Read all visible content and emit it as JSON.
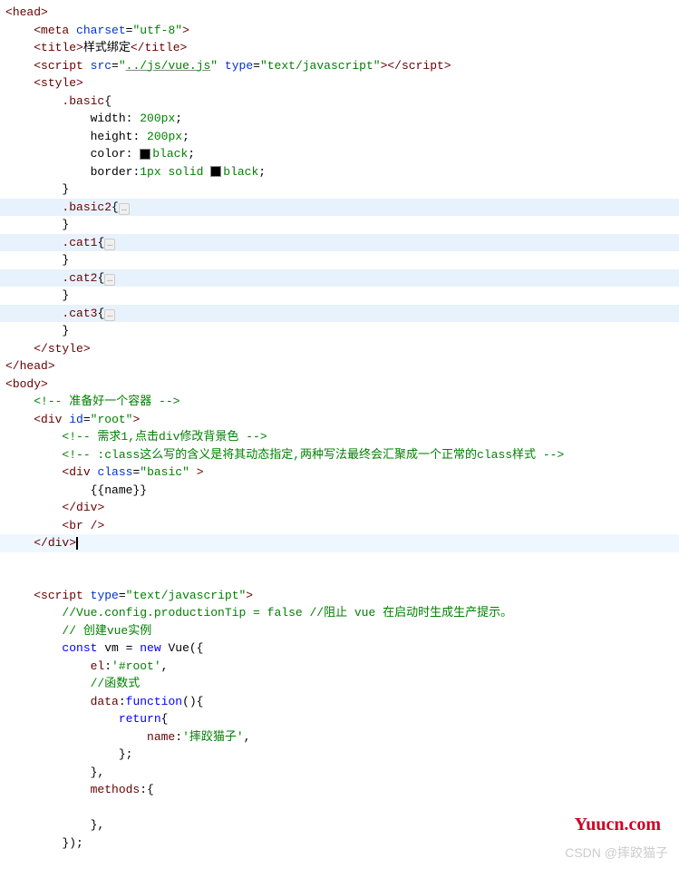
{
  "lines": [
    {
      "ind": 0,
      "segs": [
        {
          "t": "<",
          "c": "tag-bracket"
        },
        {
          "t": "head",
          "c": "tag-name"
        },
        {
          "t": ">",
          "c": "tag-bracket"
        }
      ]
    },
    {
      "ind": 1,
      "segs": [
        {
          "t": "<",
          "c": "tag-bracket"
        },
        {
          "t": "meta ",
          "c": "tag-name"
        },
        {
          "t": "charset",
          "c": "attr-name"
        },
        {
          "t": "=",
          "c": "plain"
        },
        {
          "t": "\"utf-8\"",
          "c": "attr-value"
        },
        {
          "t": ">",
          "c": "tag-bracket"
        }
      ]
    },
    {
      "ind": 1,
      "segs": [
        {
          "t": "<",
          "c": "tag-bracket"
        },
        {
          "t": "title",
          "c": "tag-name"
        },
        {
          "t": ">",
          "c": "tag-bracket"
        },
        {
          "t": "样式绑定",
          "c": "plain"
        },
        {
          "t": "</",
          "c": "tag-bracket"
        },
        {
          "t": "title",
          "c": "tag-name"
        },
        {
          "t": ">",
          "c": "tag-bracket"
        }
      ]
    },
    {
      "ind": 1,
      "segs": [
        {
          "t": "<",
          "c": "tag-bracket"
        },
        {
          "t": "script ",
          "c": "tag-name"
        },
        {
          "t": "src",
          "c": "attr-name"
        },
        {
          "t": "=",
          "c": "plain"
        },
        {
          "t": "\"",
          "c": "attr-value"
        },
        {
          "t": "../js/vue.js",
          "c": "attr-value-underline"
        },
        {
          "t": "\"",
          "c": "attr-value"
        },
        {
          "t": " ",
          "c": "plain"
        },
        {
          "t": "type",
          "c": "attr-name"
        },
        {
          "t": "=",
          "c": "plain"
        },
        {
          "t": "\"text/javascript\"",
          "c": "attr-value"
        },
        {
          "t": "></",
          "c": "tag-bracket"
        },
        {
          "t": "script",
          "c": "tag-name"
        },
        {
          "t": ">",
          "c": "tag-bracket"
        }
      ]
    },
    {
      "ind": 1,
      "segs": [
        {
          "t": "<",
          "c": "tag-bracket"
        },
        {
          "t": "style",
          "c": "tag-name"
        },
        {
          "t": ">",
          "c": "tag-bracket"
        }
      ]
    },
    {
      "ind": 2,
      "segs": [
        {
          "t": ".basic",
          "c": "css-selector"
        },
        {
          "t": "{",
          "c": "css-brace"
        }
      ]
    },
    {
      "ind": 3,
      "segs": [
        {
          "t": "width",
          "c": "css-prop"
        },
        {
          "t": ": ",
          "c": "plain"
        },
        {
          "t": "200px",
          "c": "attr-value"
        },
        {
          "t": ";",
          "c": "plain"
        }
      ]
    },
    {
      "ind": 3,
      "segs": [
        {
          "t": "height",
          "c": "css-prop"
        },
        {
          "t": ": ",
          "c": "plain"
        },
        {
          "t": "200px",
          "c": "attr-value"
        },
        {
          "t": ";",
          "c": "plain"
        }
      ]
    },
    {
      "ind": 3,
      "segs": [
        {
          "t": "color",
          "c": "css-prop"
        },
        {
          "t": ": ",
          "c": "plain"
        },
        {
          "swatch": "#000"
        },
        {
          "t": "black",
          "c": "attr-value"
        },
        {
          "t": ";",
          "c": "plain"
        }
      ]
    },
    {
      "ind": 3,
      "segs": [
        {
          "t": "border",
          "c": "css-prop"
        },
        {
          "t": ":",
          "c": "plain"
        },
        {
          "t": "1px solid ",
          "c": "attr-value"
        },
        {
          "swatch": "#000"
        },
        {
          "t": "black",
          "c": "attr-value"
        },
        {
          "t": ";",
          "c": "plain"
        }
      ]
    },
    {
      "ind": 2,
      "segs": [
        {
          "t": "}",
          "c": "css-brace"
        }
      ]
    },
    {
      "ind": 2,
      "hl": true,
      "segs": [
        {
          "t": ".basic2",
          "c": "css-selector"
        },
        {
          "t": "{",
          "c": "css-brace"
        },
        {
          "fold": true
        }
      ]
    },
    {
      "ind": 2,
      "segs": [
        {
          "t": "}",
          "c": "css-brace"
        }
      ]
    },
    {
      "ind": 2,
      "hl": true,
      "segs": [
        {
          "t": ".cat1",
          "c": "css-selector"
        },
        {
          "t": "{",
          "c": "css-brace"
        },
        {
          "fold": true
        }
      ]
    },
    {
      "ind": 2,
      "segs": [
        {
          "t": "}",
          "c": "css-brace"
        }
      ]
    },
    {
      "ind": 2,
      "hl": true,
      "segs": [
        {
          "t": ".cat2",
          "c": "css-selector"
        },
        {
          "t": "{",
          "c": "css-brace"
        },
        {
          "fold": true
        }
      ]
    },
    {
      "ind": 2,
      "segs": [
        {
          "t": "}",
          "c": "css-brace"
        }
      ]
    },
    {
      "ind": 2,
      "hl": true,
      "segs": [
        {
          "t": ".cat3",
          "c": "css-selector"
        },
        {
          "t": "{",
          "c": "css-brace"
        },
        {
          "fold": true
        }
      ]
    },
    {
      "ind": 2,
      "segs": [
        {
          "t": "}",
          "c": "css-brace"
        }
      ]
    },
    {
      "ind": 1,
      "segs": [
        {
          "t": "</",
          "c": "tag-bracket"
        },
        {
          "t": "style",
          "c": "tag-name"
        },
        {
          "t": ">",
          "c": "tag-bracket"
        }
      ]
    },
    {
      "ind": 0,
      "segs": [
        {
          "t": "</",
          "c": "tag-bracket"
        },
        {
          "t": "head",
          "c": "tag-name"
        },
        {
          "t": ">",
          "c": "tag-bracket"
        }
      ]
    },
    {
      "ind": 0,
      "segs": [
        {
          "t": "<",
          "c": "tag-bracket"
        },
        {
          "t": "body",
          "c": "tag-name"
        },
        {
          "t": ">",
          "c": "tag-bracket"
        }
      ]
    },
    {
      "ind": 1,
      "segs": [
        {
          "t": "<!-- 准备好一个容器 -->",
          "c": "comment"
        }
      ]
    },
    {
      "ind": 1,
      "segs": [
        {
          "t": "<",
          "c": "tag-bracket"
        },
        {
          "t": "div ",
          "c": "tag-name"
        },
        {
          "t": "id",
          "c": "attr-name"
        },
        {
          "t": "=",
          "c": "plain"
        },
        {
          "t": "\"root\"",
          "c": "attr-value"
        },
        {
          "t": ">",
          "c": "tag-bracket"
        }
      ]
    },
    {
      "ind": 2,
      "segs": [
        {
          "t": "<!-- 需求1,点击div修改背景色 -->",
          "c": "comment"
        }
      ]
    },
    {
      "ind": 2,
      "segs": [
        {
          "t": "<!-- :class这么写的含义是将其动态指定,两种写法最终会汇聚成一个正常的class样式 -->",
          "c": "comment"
        }
      ]
    },
    {
      "ind": 2,
      "segs": [
        {
          "t": "<",
          "c": "tag-bracket"
        },
        {
          "t": "div ",
          "c": "tag-name"
        },
        {
          "t": "class",
          "c": "attr-name"
        },
        {
          "t": "=",
          "c": "plain"
        },
        {
          "t": "\"basic\"",
          "c": "attr-value"
        },
        {
          "t": " >",
          "c": "tag-bracket"
        }
      ]
    },
    {
      "ind": 3,
      "segs": [
        {
          "t": "{{name}}",
          "c": "plain"
        }
      ]
    },
    {
      "ind": 2,
      "segs": [
        {
          "t": "</",
          "c": "tag-bracket"
        },
        {
          "t": "div",
          "c": "tag-name"
        },
        {
          "t": ">",
          "c": "tag-bracket"
        }
      ]
    },
    {
      "ind": 2,
      "segs": [
        {
          "t": "<",
          "c": "tag-bracket"
        },
        {
          "t": "br ",
          "c": "tag-name"
        },
        {
          "t": "/>",
          "c": "tag-bracket"
        }
      ]
    },
    {
      "ind": 1,
      "hlc": true,
      "segs": [
        {
          "t": "</",
          "c": "tag-bracket"
        },
        {
          "t": "div",
          "c": "tag-name"
        },
        {
          "t": ">",
          "c": "tag-bracket"
        },
        {
          "cursor": true
        }
      ]
    },
    {
      "ind": 0,
      "segs": []
    },
    {
      "ind": 0,
      "segs": []
    },
    {
      "ind": 1,
      "segs": [
        {
          "t": "<",
          "c": "tag-bracket"
        },
        {
          "t": "script ",
          "c": "tag-name"
        },
        {
          "t": "type",
          "c": "attr-name"
        },
        {
          "t": "=",
          "c": "plain"
        },
        {
          "t": "\"text/javascript\"",
          "c": "attr-value"
        },
        {
          "t": ">",
          "c": "tag-bracket"
        }
      ]
    },
    {
      "ind": 2,
      "segs": [
        {
          "t": "//Vue.config.productionTip = false //阻止 vue 在启动时生成生产提示。",
          "c": "comment"
        }
      ]
    },
    {
      "ind": 2,
      "segs": [
        {
          "t": "// 创建vue实例",
          "c": "comment"
        }
      ]
    },
    {
      "ind": 2,
      "segs": [
        {
          "t": "const ",
          "c": "keyword"
        },
        {
          "t": "vm ",
          "c": "plain"
        },
        {
          "t": "= ",
          "c": "plain"
        },
        {
          "t": "new ",
          "c": "keyword"
        },
        {
          "t": "Vue",
          "c": "plain"
        },
        {
          "t": "({",
          "c": "plain"
        }
      ]
    },
    {
      "ind": 3,
      "segs": [
        {
          "t": "el",
          "c": "js-key"
        },
        {
          "t": ":",
          "c": "plain"
        },
        {
          "t": "'#root'",
          "c": "string"
        },
        {
          "t": ",",
          "c": "plain"
        }
      ]
    },
    {
      "ind": 3,
      "segs": [
        {
          "t": "//函数式",
          "c": "comment"
        }
      ]
    },
    {
      "ind": 3,
      "segs": [
        {
          "t": "data",
          "c": "js-key"
        },
        {
          "t": ":",
          "c": "plain"
        },
        {
          "t": "function",
          "c": "keyword"
        },
        {
          "t": "(){",
          "c": "plain"
        }
      ]
    },
    {
      "ind": 4,
      "segs": [
        {
          "t": "return",
          "c": "keyword"
        },
        {
          "t": "{",
          "c": "plain"
        }
      ]
    },
    {
      "ind": 5,
      "segs": [
        {
          "t": "name",
          "c": "js-key"
        },
        {
          "t": ":",
          "c": "plain"
        },
        {
          "t": "'摔跤猫子'",
          "c": "string"
        },
        {
          "t": ",",
          "c": "plain"
        }
      ]
    },
    {
      "ind": 4,
      "segs": [
        {
          "t": "};",
          "c": "plain"
        }
      ]
    },
    {
      "ind": 3,
      "segs": [
        {
          "t": "},",
          "c": "plain"
        }
      ]
    },
    {
      "ind": 3,
      "segs": [
        {
          "t": "methods",
          "c": "js-key"
        },
        {
          "t": ":{",
          "c": "plain"
        }
      ]
    },
    {
      "ind": 3,
      "segs": []
    },
    {
      "ind": 3,
      "segs": [
        {
          "t": "},",
          "c": "plain"
        }
      ]
    },
    {
      "ind": 2,
      "segs": [
        {
          "t": "});",
          "c": "plain"
        }
      ]
    }
  ],
  "indent": "    ",
  "watermark_logo": "Yuucn.com",
  "watermark_csdn": "CSDN @摔跤猫子"
}
